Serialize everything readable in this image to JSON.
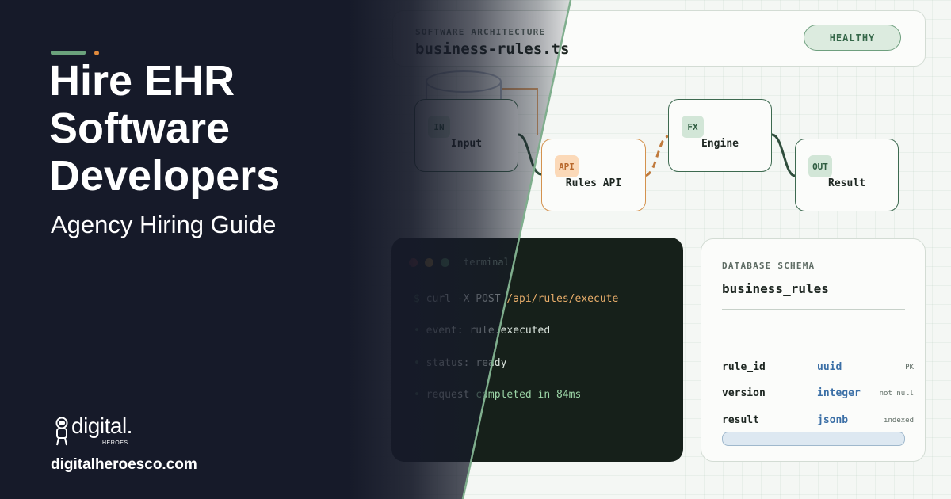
{
  "hero": {
    "title_lines": [
      "Hire EHR",
      "Software",
      "Developers"
    ],
    "subtitle": "Agency Hiring Guide",
    "site_url": "digitalheroesco.com",
    "logo": {
      "word": "digital.",
      "sub": "HEROES"
    }
  },
  "header": {
    "section_label": "SOFTWARE ARCHITECTURE",
    "file_name": "business-rules.ts",
    "status_badge": "HEALTHY"
  },
  "flow": {
    "nodes": [
      {
        "tag": "IN",
        "label": "Input"
      },
      {
        "tag": "API",
        "label": "Rules API"
      },
      {
        "tag": "FX",
        "label": "Engine"
      },
      {
        "tag": "OUT",
        "label": "Result"
      }
    ]
  },
  "terminal": {
    "title": "terminal",
    "lines": [
      {
        "prefix": "$",
        "text": "curl -X POST",
        "accent": "/api/rules/execute"
      },
      {
        "prefix": "•",
        "text": "event:",
        "accent": "rule.executed"
      },
      {
        "prefix": "•",
        "text": "status:",
        "accent": "ready"
      },
      {
        "prefix": "•",
        "text": "request",
        "accent": "completed in 84ms"
      }
    ]
  },
  "schema": {
    "section_label": "DATABASE SCHEMA",
    "table_name": "business_rules",
    "columns": [
      {
        "name": "rule_id",
        "type": "uuid",
        "flag": "PK"
      },
      {
        "name": "version",
        "type": "integer",
        "flag": "not null"
      },
      {
        "name": "result",
        "type": "jsonb",
        "flag": "indexed"
      }
    ]
  },
  "colors": {
    "dark_bg": "#161a29",
    "accent_green": "#6ba27c",
    "accent_orange": "#e08a3c",
    "node_border": "#3d6a50",
    "api_border": "#d4924e"
  }
}
